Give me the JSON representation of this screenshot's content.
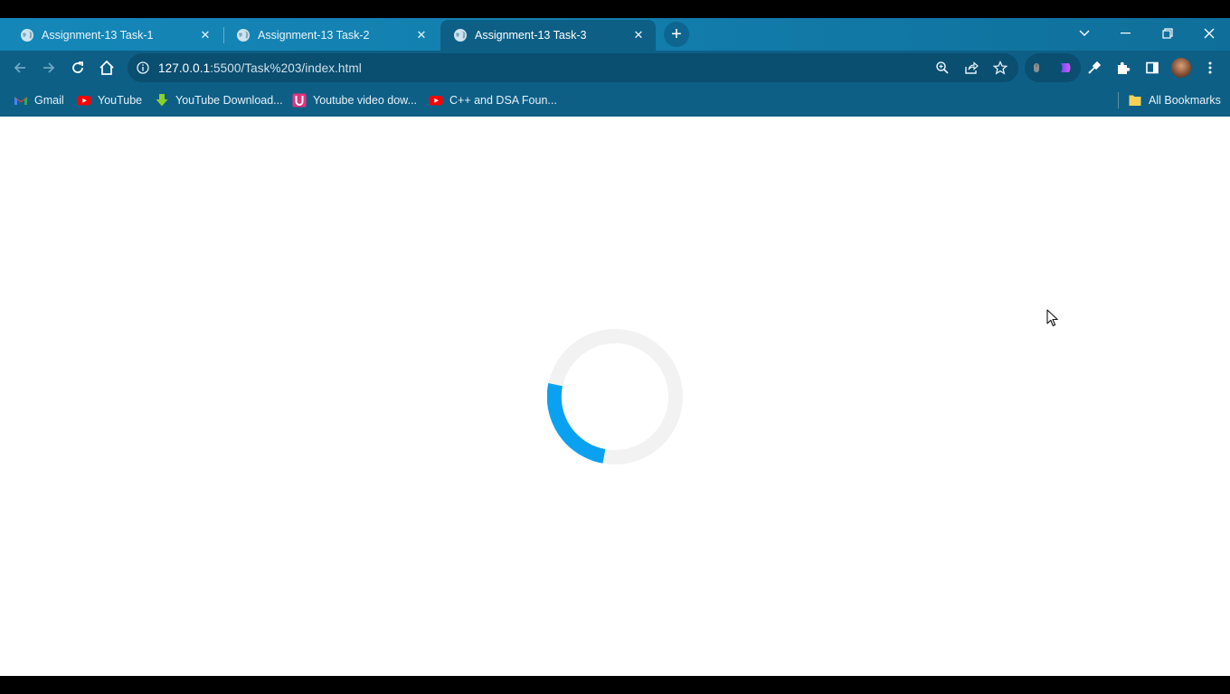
{
  "tabs": [
    {
      "title": "Assignment-13 Task-1",
      "active": false
    },
    {
      "title": "Assignment-13 Task-2",
      "active": false
    },
    {
      "title": "Assignment-13 Task-3",
      "active": true
    }
  ],
  "address_bar": {
    "host": "127.0.0.1",
    "path": ":5500/Task%203/index.html"
  },
  "bookmarks": [
    {
      "label": "Gmail",
      "icon": "gmail-icon"
    },
    {
      "label": "YouTube",
      "icon": "youtube-icon"
    },
    {
      "label": "YouTube Download...",
      "icon": "download-arrow-icon"
    },
    {
      "label": "Youtube video dow...",
      "icon": "u-logo-icon"
    },
    {
      "label": "C++ and DSA Foun...",
      "icon": "youtube-icon"
    }
  ],
  "all_bookmarks": {
    "label": "All Bookmarks",
    "icon": "folder-icon"
  },
  "spinner": {
    "track_color": "#f2f2f2",
    "arc_color": "#0aa2f0"
  },
  "colors": {
    "chrome_bg": "#137fae",
    "toolbar_bg": "#0d5f86",
    "omnibox_bg": "#0a4e70"
  }
}
